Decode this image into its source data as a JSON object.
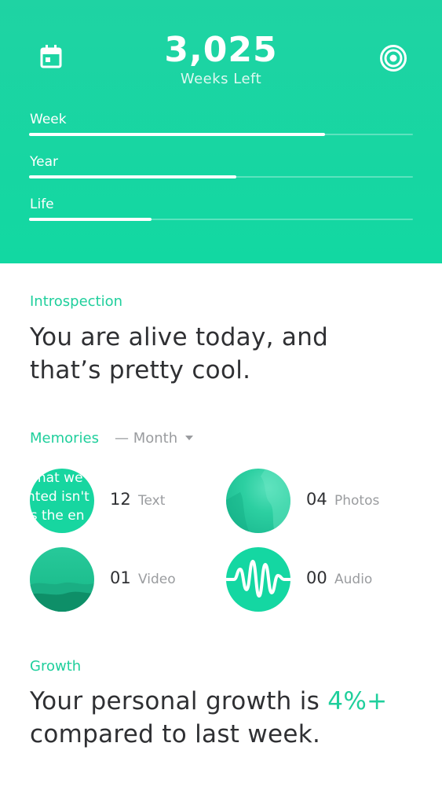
{
  "header": {
    "weeks_count": "3,025",
    "weeks_label": "Weeks Left",
    "icons": {
      "left": "calendar-icon",
      "right": "target-icon"
    },
    "progress": [
      {
        "label": "Week",
        "fraction": 0.77
      },
      {
        "label": "Year",
        "fraction": 0.54
      },
      {
        "label": "Life",
        "fraction": 0.32
      }
    ]
  },
  "introspection": {
    "title": "Introspection",
    "line1": "You are alive today, and",
    "line2": "that’s pretty cool."
  },
  "memories": {
    "title": "Memories",
    "filter": "— Month",
    "items": [
      {
        "count": "12",
        "kind": "Text",
        "preview_lines": [
          "what we",
          "nted isn't",
          "is the en"
        ]
      },
      {
        "count": "04",
        "kind": "Photos"
      },
      {
        "count": "01",
        "kind": "Video"
      },
      {
        "count": "00",
        "kind": "Audio"
      }
    ]
  },
  "growth": {
    "title": "Growth",
    "line1_prefix": "Your personal growth is ",
    "line1_value": "4%+",
    "line2": "compared to last week."
  },
  "colors": {
    "accent": "#1fcf9c",
    "header_bg": "#16d5a2",
    "text_primary": "#2f3033",
    "text_muted": "#9a9c9f"
  }
}
